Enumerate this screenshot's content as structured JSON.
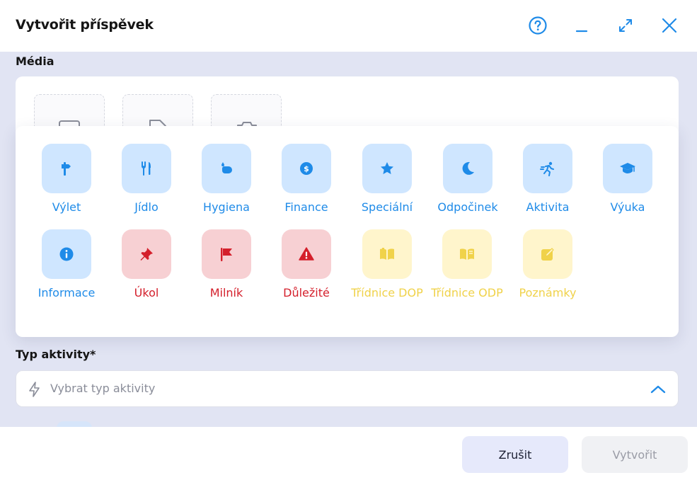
{
  "dialog": {
    "title": "Vytvořit příspěvek",
    "controls": {
      "help_icon": "question-circle-icon",
      "minimize_icon": "minimize-icon",
      "expand_icon": "expand-icon",
      "close_icon": "close-icon"
    }
  },
  "media": {
    "label": "Média",
    "slots": [
      {
        "icon": "image-icon"
      },
      {
        "icon": "file-icon"
      },
      {
        "icon": "camera-icon"
      }
    ]
  },
  "categories": [
    {
      "label": "Výlet",
      "icon": "signpost-icon",
      "color": "blue"
    },
    {
      "label": "Jídlo",
      "icon": "utensils-icon",
      "color": "blue"
    },
    {
      "label": "Hygiena",
      "icon": "hand-wash-icon",
      "color": "blue"
    },
    {
      "label": "Finance",
      "icon": "dollar-coin-icon",
      "color": "blue"
    },
    {
      "label": "Speciální",
      "icon": "star-icon",
      "color": "blue"
    },
    {
      "label": "Odpočinek",
      "icon": "moon-icon",
      "color": "blue"
    },
    {
      "label": "Aktivita",
      "icon": "running-icon",
      "color": "blue"
    },
    {
      "label": "Výuka",
      "icon": "graduation-cap-icon",
      "color": "blue"
    },
    {
      "label": "Informace",
      "icon": "info-icon",
      "color": "blue"
    },
    {
      "label": "Úkol",
      "icon": "pin-icon",
      "color": "red"
    },
    {
      "label": "Milník",
      "icon": "flag-icon",
      "color": "red"
    },
    {
      "label": "Důležité",
      "icon": "warning-icon",
      "color": "red"
    },
    {
      "label": "Třídnice DOP",
      "icon": "book-open-icon",
      "color": "yellow"
    },
    {
      "label": "Třídnice ODP",
      "icon": "book-icon",
      "color": "yellow"
    },
    {
      "label": "Poznámky",
      "icon": "note-edit-icon",
      "color": "yellow"
    }
  ],
  "activity_type": {
    "label": "Typ aktivity*",
    "placeholder": "Vybrat typ aktivity",
    "icon": "lightning-icon",
    "chevron": "chevron-up-icon"
  },
  "footer": {
    "cancel_label": "Zrušit",
    "create_label": "Vytvořit"
  },
  "colors": {
    "accent_blue": "#1f8be8",
    "tile_blue": "#cfe6ff",
    "accent_red": "#d41f2b",
    "tile_red": "#f7d0d3",
    "accent_yellow": "#f0d24a",
    "tile_yellow": "#fff5cc",
    "content_bg": "#e1e4f3"
  }
}
